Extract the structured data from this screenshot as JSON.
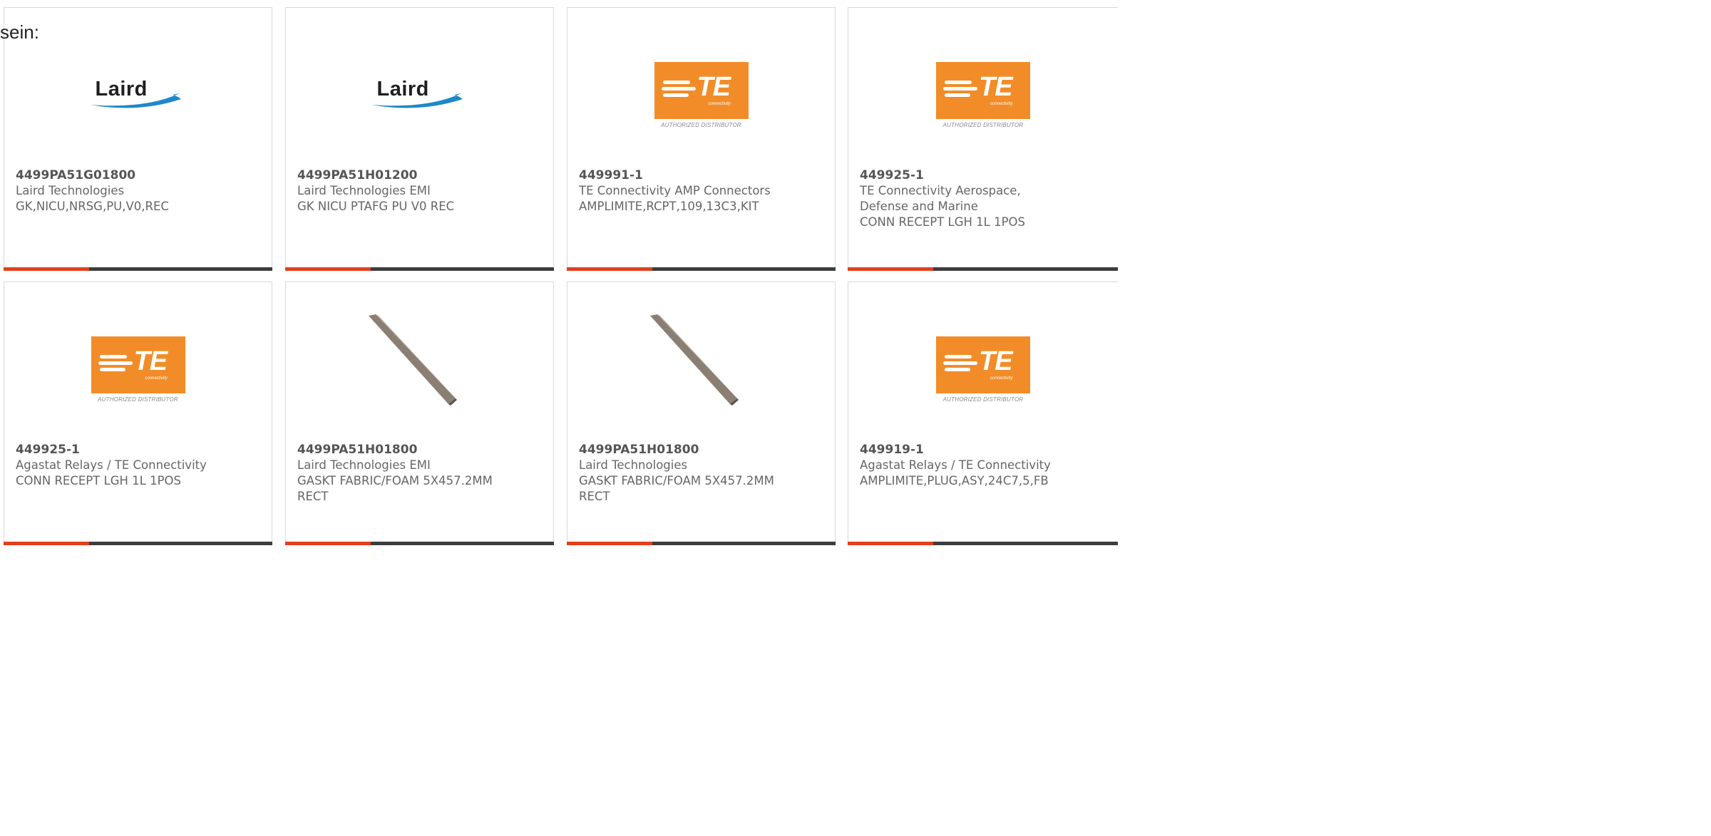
{
  "caption": "sein:",
  "cards": [
    {
      "part_number": "4499PA51G01800",
      "manufacturer": "Laird Technologies",
      "description": "GK,NICU,NRSG,PU,V0,REC",
      "image": "laird-logo",
      "brand_text": "Laird"
    },
    {
      "part_number": "4499PA51H01200",
      "manufacturer": "Laird Technologies EMI",
      "description": "GK NICU PTAFG PU V0 REC",
      "image": "laird-logo",
      "brand_text": "Laird"
    },
    {
      "part_number": "449991-1",
      "manufacturer": "TE Connectivity AMP Connectors",
      "description": "AMPLIMITE,RCPT,109,13C3,KIT",
      "image": "te-logo",
      "brand_text": "TE",
      "brand_sub": "connectivity",
      "brand_tag": "AUTHORIZED DISTRIBUTOR"
    },
    {
      "part_number": "449925-1",
      "manufacturer": "TE Connectivity Aerospace, Defense and Marine",
      "description": "CONN RECEPT LGH 1L 1POS",
      "image": "te-logo",
      "brand_text": "TE",
      "brand_sub": "connectivity",
      "brand_tag": "AUTHORIZED DISTRIBUTOR"
    },
    {
      "part_number": "449925-1",
      "manufacturer": "Agastat Relays / TE Connectivity",
      "description": "CONN RECEPT LGH 1L 1POS",
      "image": "te-logo",
      "brand_text": "TE",
      "brand_sub": "connectivity",
      "brand_tag": "AUTHORIZED DISTRIBUTOR"
    },
    {
      "part_number": "4499PA51H01800",
      "manufacturer": "Laird Technologies EMI",
      "description": "GASKT FABRIC/FOAM 5X457.2MM RECT",
      "image": "gasket-photo"
    },
    {
      "part_number": "4499PA51H01800",
      "manufacturer": "Laird Technologies",
      "description": "GASKT FABRIC/FOAM 5X457.2MM RECT",
      "image": "gasket-photo"
    },
    {
      "part_number": "449919-1",
      "manufacturer": "Agastat Relays / TE Connectivity",
      "description": "AMPLIMITE,PLUG,ASY,24C7,5,FB",
      "image": "te-logo",
      "brand_text": "TE",
      "brand_sub": "connectivity",
      "brand_tag": "AUTHORIZED DISTRIBUTOR"
    }
  ],
  "colors": {
    "accent": "#e1401b",
    "bar": "#3d3d3d",
    "te_orange": "#f28c28",
    "laird_blue": "#1e88c8"
  }
}
